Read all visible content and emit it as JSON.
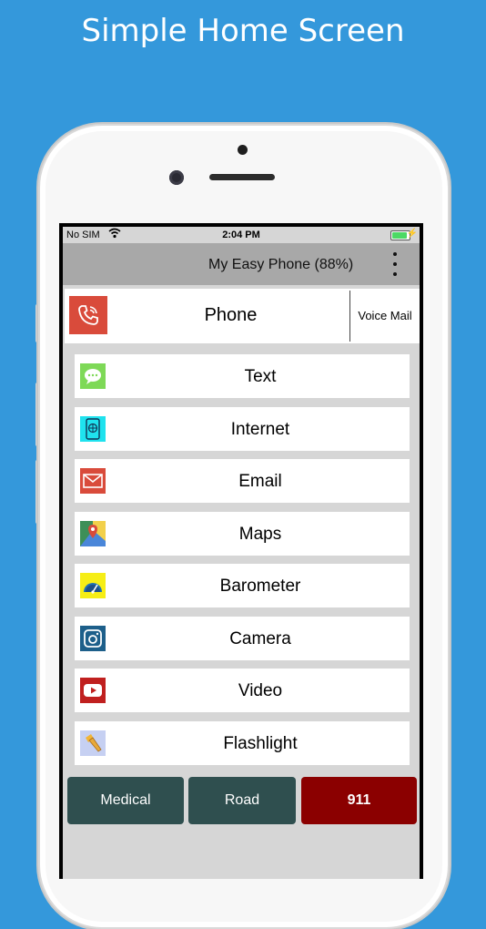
{
  "headline": "Simple Home Screen",
  "status": {
    "carrier": "No SIM",
    "time": "2:04 PM",
    "battery_level": 0.9
  },
  "appbar": {
    "title": "My Easy Phone (88%)",
    "menu_icon": "more-vertical-icon"
  },
  "phone_row": {
    "label": "Phone",
    "voicemail_label": "Voice Mail",
    "icon": "phone-call-icon",
    "icon_color": "#d94b3b"
  },
  "items": [
    {
      "label": "Text",
      "icon": "message-bubble-icon",
      "color": "#7ed957"
    },
    {
      "label": "Internet",
      "icon": "globe-device-icon",
      "color": "#1fe2ee"
    },
    {
      "label": "Email",
      "icon": "envelope-icon",
      "color": "#d94b3b"
    },
    {
      "label": "Maps",
      "icon": "map-pin-icon",
      "color": "#3d8f58"
    },
    {
      "label": "Barometer",
      "icon": "gauge-icon",
      "color": "#f6ee16"
    },
    {
      "label": "Camera",
      "icon": "camera-icon",
      "color": "#1d5f8a"
    },
    {
      "label": "Video",
      "icon": "play-icon",
      "color": "#c0201f"
    },
    {
      "label": "Flashlight",
      "icon": "flashlight-icon",
      "color": "#c6d0f2"
    }
  ],
  "bottom_buttons": [
    {
      "label": "Medical",
      "color": "#2f4f4f"
    },
    {
      "label": "Road",
      "color": "#2f4f4f"
    },
    {
      "label": "911",
      "color": "#8b0000"
    }
  ]
}
